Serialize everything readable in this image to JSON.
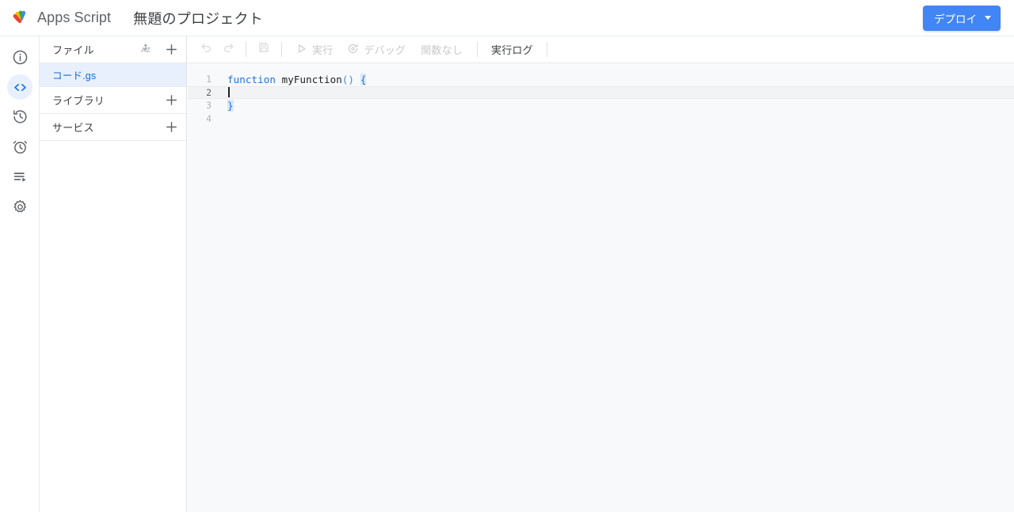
{
  "header": {
    "logo_icon": "apps-script-logo",
    "brand_name": "Apps Script",
    "project_title": "無題のプロジェクト",
    "deploy": {
      "label": "デプロイ",
      "caret_icon": "chevron-down-icon",
      "color": "#4285f4"
    }
  },
  "rail": {
    "items": [
      {
        "icon": "info-icon",
        "name": "overview",
        "active": false
      },
      {
        "icon": "code-icon",
        "name": "editor",
        "active": true
      },
      {
        "icon": "history-icon",
        "name": "history",
        "active": false
      },
      {
        "icon": "alarm-icon",
        "name": "triggers",
        "active": false
      },
      {
        "icon": "executions-icon",
        "name": "executions",
        "active": false
      },
      {
        "icon": "gear-icon",
        "name": "settings",
        "active": false
      }
    ],
    "active_background": "#e8f0fe",
    "active_color": "#1a73e8"
  },
  "file_panel": {
    "files_header": {
      "label": "ファイル",
      "sort_icon": "sort-az-icon",
      "add_icon": "plus-icon"
    },
    "files": [
      {
        "name": "コード.gs",
        "selected": true
      }
    ],
    "libraries_header": {
      "label": "ライブラリ",
      "add_icon": "plus-icon"
    },
    "services_header": {
      "label": "サービス",
      "add_icon": "plus-icon"
    },
    "selected_background": "#e8f0fe",
    "selected_color": "#1967d2"
  },
  "toolbar": {
    "undo_icon": "undo-icon",
    "redo_icon": "redo-icon",
    "save_icon": "save-icon",
    "run": {
      "label": "実行",
      "icon": "play-icon",
      "enabled": false
    },
    "debug": {
      "label": "デバッグ",
      "icon": "debug-icon",
      "enabled": false
    },
    "function_select": {
      "label": "関数なし",
      "enabled": false
    },
    "execution_log": {
      "label": "実行ログ",
      "enabled": true
    }
  },
  "code": {
    "lines": [
      {
        "number": "1",
        "active": false
      },
      {
        "number": "2",
        "active": true
      },
      {
        "number": "3",
        "active": false
      },
      {
        "number": "4",
        "active": false
      }
    ],
    "tokens": {
      "keyword": "function",
      "space": " ",
      "fn_name": "myFunction",
      "parens": "()",
      "open_brace": "{",
      "close_brace": "}"
    },
    "language": "gs",
    "cursor_line": 2
  }
}
